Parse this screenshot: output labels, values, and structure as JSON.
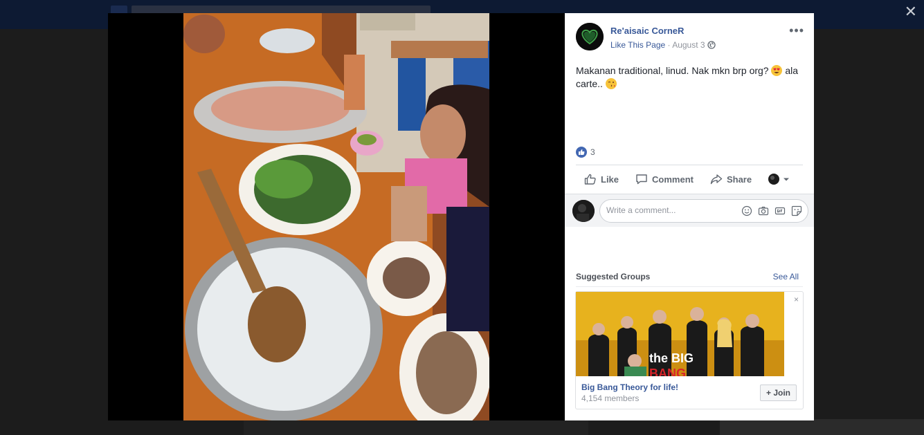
{
  "post": {
    "page_name": "Re'aisaic CorneR",
    "like_page": "Like This Page",
    "separator": "·",
    "date": "August 3",
    "options_label": "•••",
    "text_part1": "Makanan traditional, linud. Nak mkn brp org?",
    "text_part2": "ala carte..",
    "emoji_icons": [
      "heart-eyes-emoji",
      "kissing-face-emoji"
    ],
    "reaction_count": "3"
  },
  "actions": {
    "like": "Like",
    "comment": "Comment",
    "share": "Share"
  },
  "comment": {
    "placeholder": "Write a comment..."
  },
  "suggested_groups": {
    "title": "Suggested Groups",
    "see_all": "See All",
    "close": "×",
    "group": {
      "name": "Big Bang Theory for life!",
      "members": "4,154 members",
      "join_label": "+ Join",
      "logo_text_1": "the BIG",
      "logo_text_2": "BANG"
    }
  },
  "overlay": {
    "close": "✕"
  },
  "colors": {
    "link": "#385898",
    "like_blue": "#4267b2",
    "muted": "#90949c"
  }
}
